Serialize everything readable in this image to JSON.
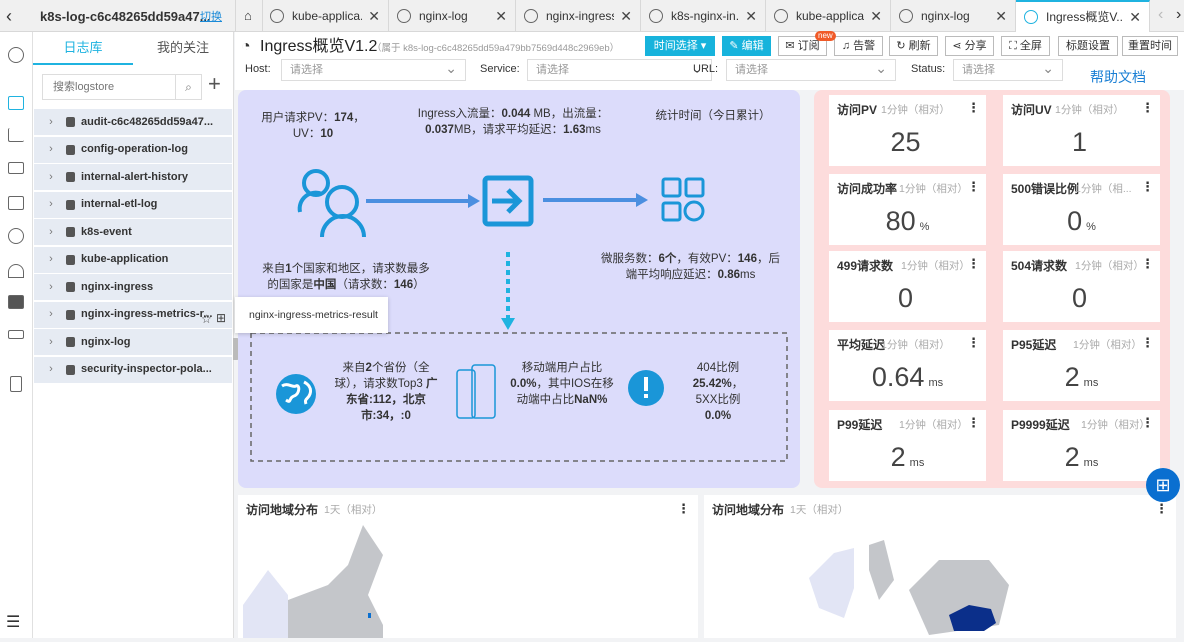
{
  "project": {
    "title": "k8s-log-c6c48265dd59a47...",
    "switch": "切换"
  },
  "tabs": [
    {
      "label": "kube-applica...",
      "icon": "search-chart-icon"
    },
    {
      "label": "nginx-log",
      "icon": "search-chart-icon"
    },
    {
      "label": "nginx-ingress",
      "icon": "search-chart-icon"
    },
    {
      "label": "k8s-nginx-in...",
      "icon": "eye-icon"
    },
    {
      "label": "kube-applica...",
      "icon": "eye-icon"
    },
    {
      "label": "nginx-log",
      "icon": "eye-icon"
    },
    {
      "label": "Ingress概览V...",
      "icon": "dashboard-icon",
      "active": true
    }
  ],
  "sidebar": {
    "tabs": [
      "日志库",
      "我的关注"
    ],
    "search_placeholder": "搜索logstore",
    "items": [
      "audit-c6c48265dd59a47...",
      "config-operation-log",
      "internal-alert-history",
      "internal-etl-log",
      "k8s-event",
      "kube-application",
      "nginx-ingress",
      "nginx-ingress-metrics-r...",
      "nginx-log",
      "security-inspector-pola..."
    ],
    "tooltip": "nginx-ingress-metrics-result"
  },
  "header": {
    "title": "Ingress概览V1.2",
    "belongs": "（属于 k8s-log-c6c48265dd59a479bb7569d448c2969eb）",
    "buttons": [
      "时间选择 ▾",
      "编辑",
      "订阅",
      "告警",
      "刷新",
      "分享",
      "全屏",
      "标题设置",
      "重置时间"
    ],
    "new_badge": "new"
  },
  "filters": [
    {
      "label": "Host:",
      "placeholder": "请选择"
    },
    {
      "label": "Service:",
      "placeholder": "请选择"
    },
    {
      "label": "URL:",
      "placeholder": "请选择"
    },
    {
      "label": "Status:",
      "placeholder": "请选择"
    }
  ],
  "help": "帮助文档",
  "flow": {
    "pv": [
      [
        "用户请求PV：",
        0
      ],
      [
        "174",
        1
      ],
      [
        "，",
        0
      ],
      [
        "\nUV：",
        0
      ],
      [
        "10",
        1
      ]
    ],
    "traffic": [
      [
        "Ingress入流量：",
        0
      ],
      [
        "0.044",
        1
      ],
      [
        " MB，出流量：",
        0
      ],
      [
        "\n0.037",
        1
      ],
      [
        "MB，请求平均延迟：",
        0
      ],
      [
        "1.63",
        1
      ],
      [
        "ms",
        0
      ]
    ],
    "stat_time": [
      [
        "统计时间（今日累计）",
        0
      ]
    ],
    "country": [
      [
        "来自",
        0
      ],
      [
        "1",
        1
      ],
      [
        "个国家和地区，请求数最多\n的国家是",
        0
      ],
      [
        "中国",
        1
      ],
      [
        "（请求数：",
        0
      ],
      [
        "146",
        1
      ],
      [
        "）",
        0
      ]
    ],
    "services": [
      [
        "微服务数：",
        0
      ],
      [
        "6个",
        1
      ],
      [
        "，有效PV：",
        0
      ],
      [
        "146",
        1
      ],
      [
        "，后\n端平均响应延迟：",
        0
      ],
      [
        "0.86",
        1
      ],
      [
        "ms",
        0
      ]
    ],
    "province": [
      [
        "来自",
        0
      ],
      [
        "2",
        1
      ],
      [
        "个省份（全\n球），请求数Top3 ",
        0
      ],
      [
        "广\n东省:112，北京\n市:34，:0",
        1
      ]
    ],
    "mobile": [
      [
        "移动端用户占比\n",
        0
      ],
      [
        "0.0%",
        1
      ],
      [
        "，其中IOS在移\n动端中占比",
        0
      ],
      [
        "NaN%",
        1
      ]
    ],
    "errors": [
      [
        "404比例\n",
        0
      ],
      [
        "25.42%",
        1
      ],
      [
        "，\n5XX比例\n",
        0
      ],
      [
        "0.0%",
        1
      ]
    ]
  },
  "cards": [
    {
      "title": "访问PV",
      "sub": "1分钟（相对）",
      "value": "25",
      "unit": ""
    },
    {
      "title": "访问UV",
      "sub": "1分钟（相对）",
      "value": "1",
      "unit": ""
    },
    {
      "title": "访问成功率",
      "sub": "1分钟（相对）",
      "value": "80",
      "unit": "%"
    },
    {
      "title": "500错误比例",
      "sub": "1分钟（相...",
      "value": "0",
      "unit": "%"
    },
    {
      "title": "499请求数",
      "sub": "1分钟（相对）",
      "value": "0",
      "unit": ""
    },
    {
      "title": "504请求数",
      "sub": "1分钟（相对）",
      "value": "0",
      "unit": ""
    },
    {
      "title": "平均延迟",
      "sub": "1分钟（相对）",
      "value": "0.64",
      "unit": "ms"
    },
    {
      "title": "P95延迟",
      "sub": "1分钟（相对）",
      "value": "2",
      "unit": "ms"
    },
    {
      "title": "P99延迟",
      "sub": "1分钟（相对）",
      "value": "2",
      "unit": "ms"
    },
    {
      "title": "P9999延迟",
      "sub": "1分钟（相对）",
      "value": "2",
      "unit": "ms"
    }
  ],
  "maps": [
    {
      "title": "访问地域分布",
      "sub": "1天（相对）"
    },
    {
      "title": "访问地域分布",
      "sub": "1天（相对）"
    }
  ],
  "colors": {
    "accent": "#17b3dc",
    "flow_bg": "#dcdcfb",
    "metrics_bg": "#fddcdc",
    "icon_blue": "#1a96d8",
    "map_gray": "#c4c6ca",
    "map_highlight": "#0b2f8a"
  }
}
